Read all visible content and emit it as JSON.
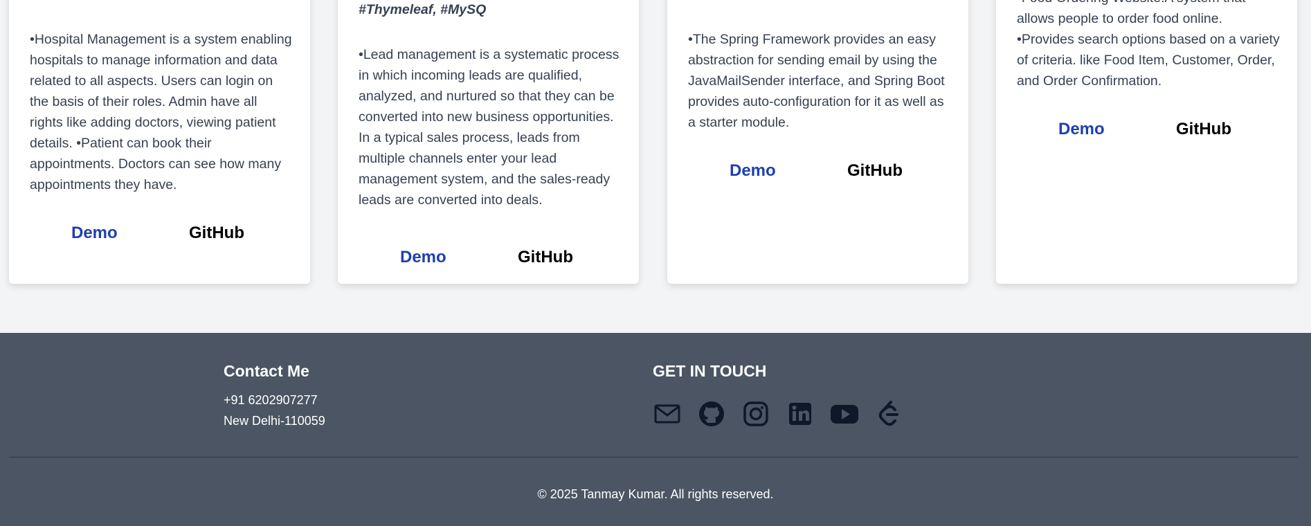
{
  "projects": [
    {
      "tech": "",
      "description": "•Hospital Management is a system enabling hospitals to manage information and data related to all aspects. Users can login on the basis of their roles. Admin have all rights like adding doctors, viewing patient details. •Patient can book their appointments. Doctors can see how many appointments they have.",
      "demo_label": "Demo",
      "github_label": "GitHub"
    },
    {
      "tech": "#SpringBoot, #SystemDesign, #Thymeleaf, #MySQ",
      "description": "•Lead management is a systematic process in which incoming leads are qualified, analyzed, and nurtured so that they can be converted into new business opportunities. In a typical sales process, leads from multiple channels enter your lead management system, and the sales-ready leads are converted into deals.",
      "demo_label": "Demo",
      "github_label": "GitHub"
    },
    {
      "tech": "",
      "description": "•The Spring Framework provides an easy abstraction for sending email by using the JavaMailSender interface, and Spring Boot provides auto-configuration for it as well as a starter module.",
      "demo_label": "Demo",
      "github_label": "GitHub"
    },
    {
      "tech": "",
      "description": "•Food Ordering Website:A system that allows people to order food online. •Provides search options based on a variety of criteria. like Food Item, Customer, Order, and Order Confirmation.",
      "demo_label": "Demo",
      "github_label": "GitHub"
    }
  ],
  "footer": {
    "contact_title": "Contact Me",
    "phone": "+91 6202907277",
    "address": "New Delhi-110059",
    "touch_title": "GET IN TOUCH",
    "socials": [
      "mail-icon",
      "github-icon",
      "instagram-icon",
      "linkedin-icon",
      "youtube-icon",
      "leetcode-icon"
    ],
    "copyright": "© 2025 Tanmay Kumar. All rights reserved."
  },
  "colors": {
    "page_bg": "#f3f4f6",
    "footer_bg": "#4b5563",
    "demo_link": "#1e40af",
    "text": "#374151"
  }
}
